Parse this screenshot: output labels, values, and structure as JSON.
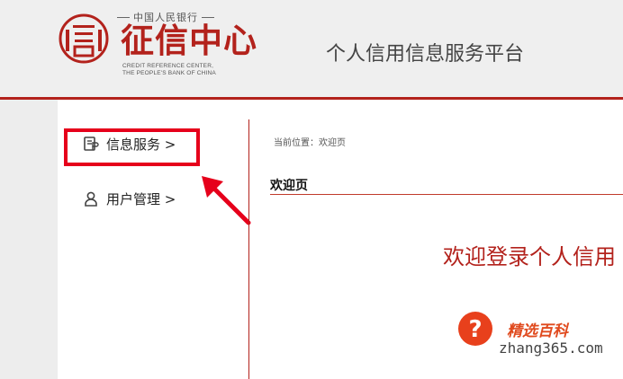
{
  "header": {
    "bank_name": "中国人民银行",
    "logo_title": "征信中心",
    "logo_en_line1": "CREDIT REFERENCE CENTER,",
    "logo_en_line2": "THE PEOPLE'S BANK OF CHINA",
    "platform_title": "个人信用信息服务平台"
  },
  "sidebar": {
    "items": [
      {
        "label": "信息服务 >",
        "icon": "document-icon"
      },
      {
        "label": "用户管理 >",
        "icon": "user-icon"
      }
    ]
  },
  "main": {
    "breadcrumb": "当前位置：欢迎页",
    "section_title": "欢迎页",
    "welcome_text": "欢迎登录个人信用"
  },
  "watermark": {
    "name": "精选百科",
    "url": "zhang365.com"
  },
  "colors": {
    "brand_red": "#b3221c",
    "highlight_red": "#e6001b",
    "background": "#ededed",
    "panel": "#ffffff"
  }
}
